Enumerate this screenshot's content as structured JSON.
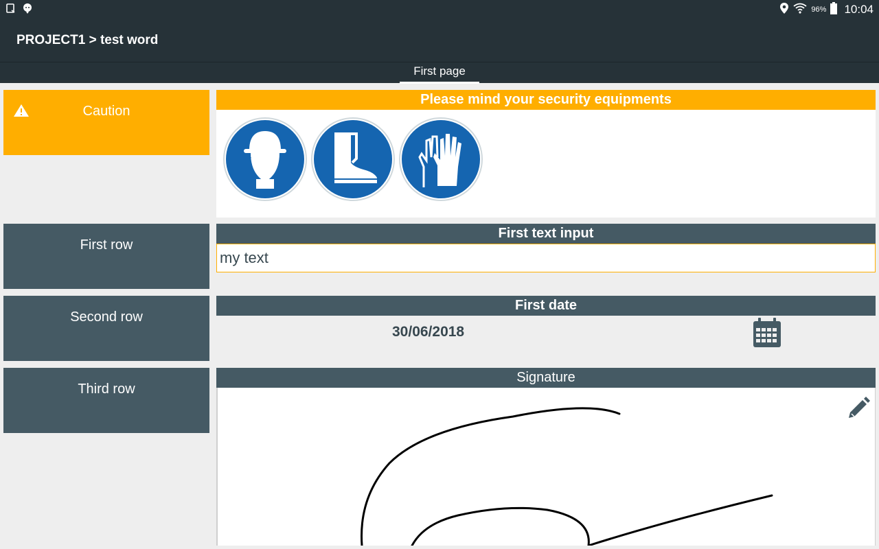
{
  "status_bar": {
    "battery": "96%",
    "time": "10:04"
  },
  "app_bar": {
    "title": "PROJECT1 > test word"
  },
  "tabs": [
    {
      "label": "First page",
      "active": true
    }
  ],
  "rows": [
    {
      "label": "Caution",
      "icon": "warning-icon"
    },
    {
      "label": "First row"
    },
    {
      "label": "Second row"
    },
    {
      "label": "Third row"
    }
  ],
  "security": {
    "header": "Please mind your security equipments",
    "equipment": [
      "helmet-icon",
      "boots-icon",
      "gloves-icon"
    ]
  },
  "text_input": {
    "header": "First text input",
    "value": "my text"
  },
  "date_field": {
    "header": "First date",
    "value": "30/06/2018"
  },
  "signature": {
    "header": "Signature"
  },
  "colors": {
    "accent": "#ffae00",
    "header": "#455a64",
    "appbar": "#263238",
    "mandatory_blue": "#1565b0"
  }
}
